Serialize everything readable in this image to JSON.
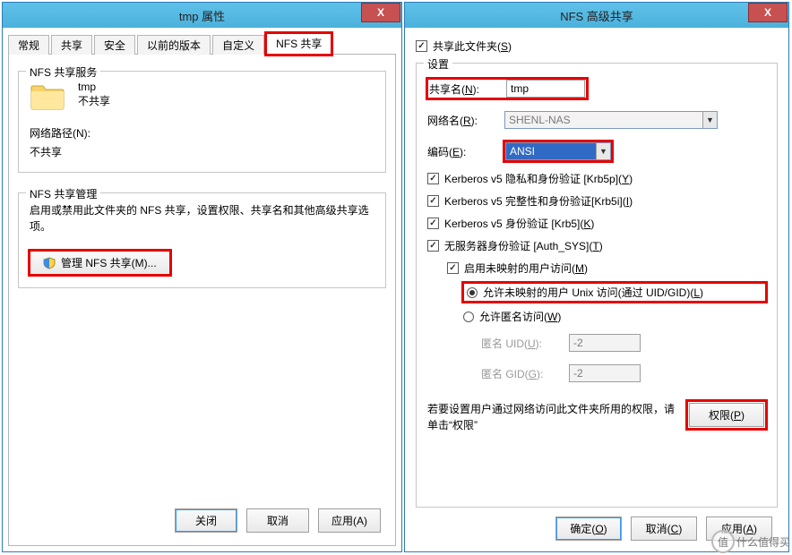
{
  "left": {
    "title": "tmp 属性",
    "close": "X",
    "tabs": {
      "general": "常规",
      "share": "共享",
      "security": "安全",
      "prev": "以前的版本",
      "custom": "自定义",
      "nfs": "NFS 共享"
    },
    "service_group": "NFS 共享服务",
    "folder_name": "tmp",
    "folder_status": "不共享",
    "netpath_label": "网络路径(N):",
    "netpath_value": "不共享",
    "mgmt_group": "NFS 共享管理",
    "mgmt_desc": "启用或禁用此文件夹的 NFS 共享，设置权限、共享名和其他高级共享选项。",
    "manage_btn": "管理 NFS 共享(M)...",
    "buttons": {
      "close_btn": "关闭",
      "cancel": "取消",
      "apply": "应用(A)"
    }
  },
  "right": {
    "title": "NFS 高级共享",
    "close": "X",
    "share_this": "共享此文件夹(",
    "share_this_u": "S",
    "share_this_end": ")",
    "settings_group": "设置",
    "sharename_lbl": "共享名(",
    "sharename_u": "N",
    "sharename_end": "):",
    "sharename_val": "tmp",
    "netname_lbl": "网络名(",
    "netname_u": "R",
    "netname_end": "):",
    "netname_val": "SHENL-NAS",
    "encode_lbl": "编码(",
    "encode_u": "E",
    "encode_end": "):",
    "encode_val": "ANSI",
    "krb5p": "Kerberos v5 隐私和身份验证 [Krb5p](",
    "krb5p_u": "Y",
    "krb5p_end": ")",
    "krb5i": "Kerberos v5 完整性和身份验证[Krb5i](",
    "krb5i_u": "I",
    "krb5i_end": ")",
    "krb5": "Kerberos v5 身份验证 [Krb5](",
    "krb5_u": "K",
    "krb5_end": ")",
    "authsys": "无服务器身份验证 [Auth_SYS](",
    "authsys_u": "T",
    "authsys_end": ")",
    "enable_unmapped": "启用未映射的用户访问(",
    "enable_unmapped_u": "M",
    "enable_unmapped_end": ")",
    "allow_unix": "允许未映射的用户 Unix 访问(通过 UID/GID)(",
    "allow_unix_u": "L",
    "allow_unix_end": ")",
    "allow_anon": "允许匿名访问(",
    "allow_anon_u": "W",
    "allow_anon_end": ")",
    "anon_uid_lbl": "匿名 UID(",
    "anon_uid_u": "U",
    "anon_uid_end": "):",
    "anon_uid_val": "-2",
    "anon_gid_lbl": "匿名 GID(",
    "anon_gid_u": "G",
    "anon_gid_end": "):",
    "anon_gid_val": "-2",
    "perm_text": "若要设置用户通过网络访问此文件夹所用的权限，请单击“权限”",
    "perm_btn": "权限(",
    "perm_btn_u": "P",
    "perm_btn_end": ")",
    "buttons": {
      "ok": "确定(",
      "ok_u": "O",
      "ok_end": ")",
      "cancel": "取消(",
      "cancel_u": "C",
      "cancel_end": ")",
      "apply": "应用(",
      "apply_u": "A",
      "apply_end": ")"
    }
  },
  "watermark": {
    "zhi": "值",
    "text": "什么值得买"
  }
}
